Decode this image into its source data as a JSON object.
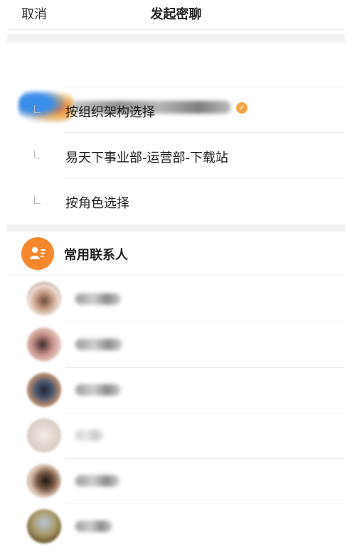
{
  "header": {
    "cancel_label": "取消",
    "title": "发起密聊"
  },
  "organization": {
    "logo_icon": "org-logo-icon",
    "verified_icon": "verified-badge-icon",
    "options": [
      {
        "label": "按组织架构选择"
      },
      {
        "label": "易天下事业部-运营部-下载站"
      },
      {
        "label": "按角色选择"
      }
    ]
  },
  "frequent_contacts": {
    "label": "常用联系人",
    "icon": "contacts-icon",
    "icon_color": "#f7872d",
    "items": [
      {
        "avatar": "avatar-1"
      },
      {
        "avatar": "avatar-2"
      },
      {
        "avatar": "avatar-3"
      },
      {
        "avatar": "avatar-4"
      },
      {
        "avatar": "avatar-5"
      },
      {
        "avatar": "avatar-6"
      }
    ]
  }
}
